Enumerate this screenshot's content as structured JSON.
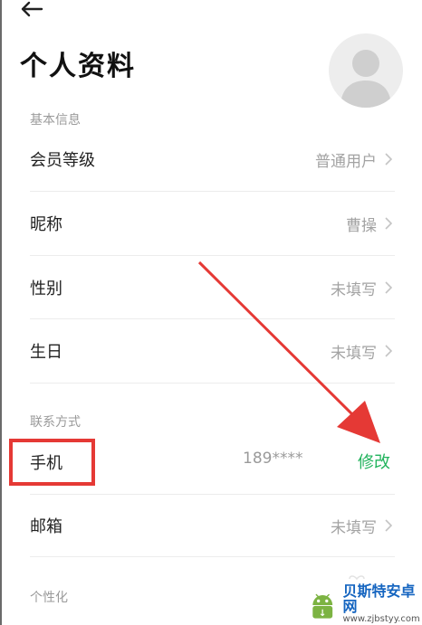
{
  "header": {
    "title": "个人资料"
  },
  "sections": {
    "basic": "基本信息",
    "contact": "联系方式",
    "personal": "个性化"
  },
  "rows": {
    "member_level": {
      "label": "会员等级",
      "value": "普通用户"
    },
    "nickname": {
      "label": "昵称",
      "value": "曹操"
    },
    "gender": {
      "label": "性别",
      "value": "未填写"
    },
    "birthday": {
      "label": "生日",
      "value": "未填写"
    },
    "phone": {
      "label": "手机",
      "value": "189****",
      "action": "修改"
    },
    "email": {
      "label": "邮箱",
      "value": "未填写"
    }
  },
  "watermark": {
    "name": "贝斯特安卓网",
    "url": "www.zjbstyy.com"
  },
  "colors": {
    "accent_green": "#21b35c",
    "annotation_red": "#e53935",
    "muted_text": "#a3a3a3"
  }
}
